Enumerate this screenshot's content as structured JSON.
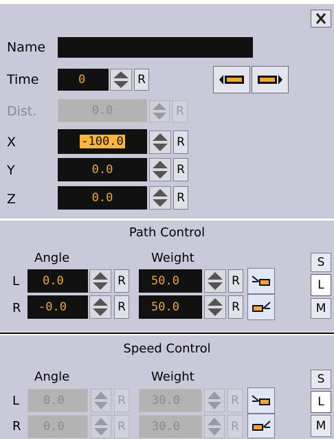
{
  "keyframe": {
    "name_label": "Name",
    "name_value": "",
    "time_label": "Time",
    "time_value": "0",
    "dist_label": "Dist.",
    "dist_value": "0.0",
    "x_label": "X",
    "x_value": "-100.0",
    "y_label": "Y",
    "y_value": "0.0",
    "z_label": "Z",
    "z_value": "0.0",
    "reset_label": "R",
    "reset_disabled_label": "R"
  },
  "path_control": {
    "title": "Path Control",
    "angle_header": "Angle",
    "weight_header": "Weight",
    "rows": [
      {
        "label": "L",
        "angle": "0.0",
        "weight": "50.0"
      },
      {
        "label": "R",
        "angle": "-0.0",
        "weight": "50.0"
      }
    ],
    "mode_buttons": [
      "S",
      "L",
      "M"
    ],
    "selected_mode": "L"
  },
  "speed_control": {
    "title": "Speed Control",
    "angle_header": "Angle",
    "weight_header": "Weight",
    "rows": [
      {
        "label": "L",
        "angle": "0.0",
        "weight": "30.0"
      },
      {
        "label": "R",
        "angle": "0.0",
        "weight": "30.0"
      }
    ],
    "mode_buttons": [
      "S",
      "L",
      "M"
    ],
    "selected_mode": "L"
  },
  "colors": {
    "panel": "#c9c9d9",
    "field_bg": "#111111",
    "field_text": "#f0a43a",
    "highlight": "#ffb43c"
  },
  "icons": [
    "close-icon",
    "prev-key-icon",
    "next-key-icon",
    "spin-arrows-icon",
    "tangent-left-icon",
    "tangent-right-icon"
  ]
}
